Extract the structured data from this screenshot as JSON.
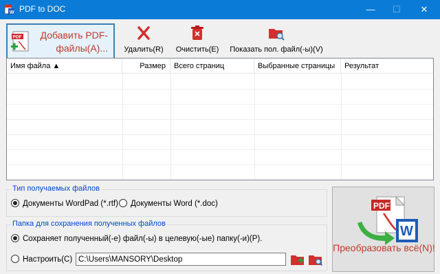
{
  "window": {
    "title": "PDF to DOC",
    "minimize": "—",
    "maximize": "☐",
    "close": "✕"
  },
  "toolbar": {
    "add_label": "Добавить PDF-файлы(A)...",
    "delete_label": "Удалить(R)",
    "clear_label": "Очистить(E)",
    "show_label": "Показать пол. файл(-ы)(V)"
  },
  "file_list": {
    "columns": [
      "Имя файла ▲",
      "Размер",
      "Всего страниц",
      "Выбранные страницы",
      "Результат"
    ],
    "rows": []
  },
  "output_type": {
    "legend": "Тип получаемых файлов",
    "options": [
      "Документы WordPad (*.rtf)",
      "Документы Word (*.doc)"
    ],
    "selected": 0
  },
  "output_folder": {
    "legend": "Папка для сохранения полученных файлов",
    "option_same": "Сохраняет полученный(-е) файл(-ы) в целевую(-ые) папку(-и)(P).",
    "option_custom": "Настроить(C)",
    "path": "C:\\Users\\MANSORY\\Desktop"
  },
  "convert": {
    "label": "Преобразовать всё(N)!"
  },
  "icons": {
    "app": "pdf-to-doc-app-icon",
    "add": "pdf-add-icon",
    "delete": "red-x-icon",
    "clear": "trash-icon",
    "show": "folder-search-icon",
    "browse_add": "folder-add-icon",
    "browse_open": "folder-open-icon",
    "convert": "pdf-to-word-icon"
  },
  "colors": {
    "titlebar": "#0a7bd7",
    "accent_text": "#c0392b",
    "legend_text": "#0046d5"
  }
}
